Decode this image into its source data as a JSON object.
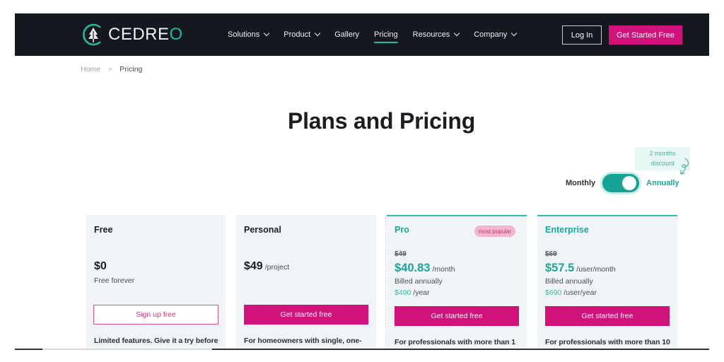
{
  "header": {
    "logo_text": "CEDRE",
    "logo_text_last": "O",
    "nav": [
      {
        "label": "Solutions",
        "has_dropdown": true,
        "active": false
      },
      {
        "label": "Product",
        "has_dropdown": true,
        "active": false
      },
      {
        "label": "Gallery",
        "has_dropdown": false,
        "active": false
      },
      {
        "label": "Pricing",
        "has_dropdown": false,
        "active": true
      },
      {
        "label": "Resources",
        "has_dropdown": true,
        "active": false
      },
      {
        "label": "Company",
        "has_dropdown": true,
        "active": false
      }
    ],
    "login_label": "Log In",
    "cta_label": "Get Started Free"
  },
  "breadcrumb": {
    "home": "Home",
    "separator": ">",
    "current": "Pricing"
  },
  "page_title": "Plans and Pricing",
  "billing": {
    "discount_note_line1": "2 months",
    "discount_note_line2": "discount",
    "monthly_label": "Monthly",
    "annually_label": "Annually",
    "selected": "Annually"
  },
  "plans": [
    {
      "name": "Free",
      "price": "$0",
      "subtitle": "Free forever",
      "button_label": "Sign up free",
      "button_style": "outline",
      "description": "Limited features. Give it a try before"
    },
    {
      "name": "Personal",
      "price": "$49",
      "price_unit": "/project",
      "button_label": "Get started free",
      "button_style": "filled",
      "description": "For homeowners with single, one-"
    },
    {
      "name": "Pro",
      "badge": "most popular",
      "old_price": "$49",
      "price": "$40.83",
      "price_unit": "/month",
      "billed": "Billed annually",
      "yearly_amount": "$490",
      "yearly_unit": "/year",
      "button_label": "Get started free",
      "button_style": "filled",
      "description": "For professionals with more than 1"
    },
    {
      "name": "Enterprise",
      "old_price": "$69",
      "price": "$57.5",
      "price_unit": "/user/month",
      "billed": "Billed annually",
      "yearly_amount": "$690",
      "yearly_unit": "/user/year",
      "button_label": "Get started free",
      "button_style": "filled",
      "description": "For professionals with more than 10"
    }
  ],
  "colors": {
    "nav_bg": "#15181f",
    "brand_teal": "#17a898",
    "brand_pink": "#d1127a",
    "card_bg": "#f0f4f6"
  }
}
